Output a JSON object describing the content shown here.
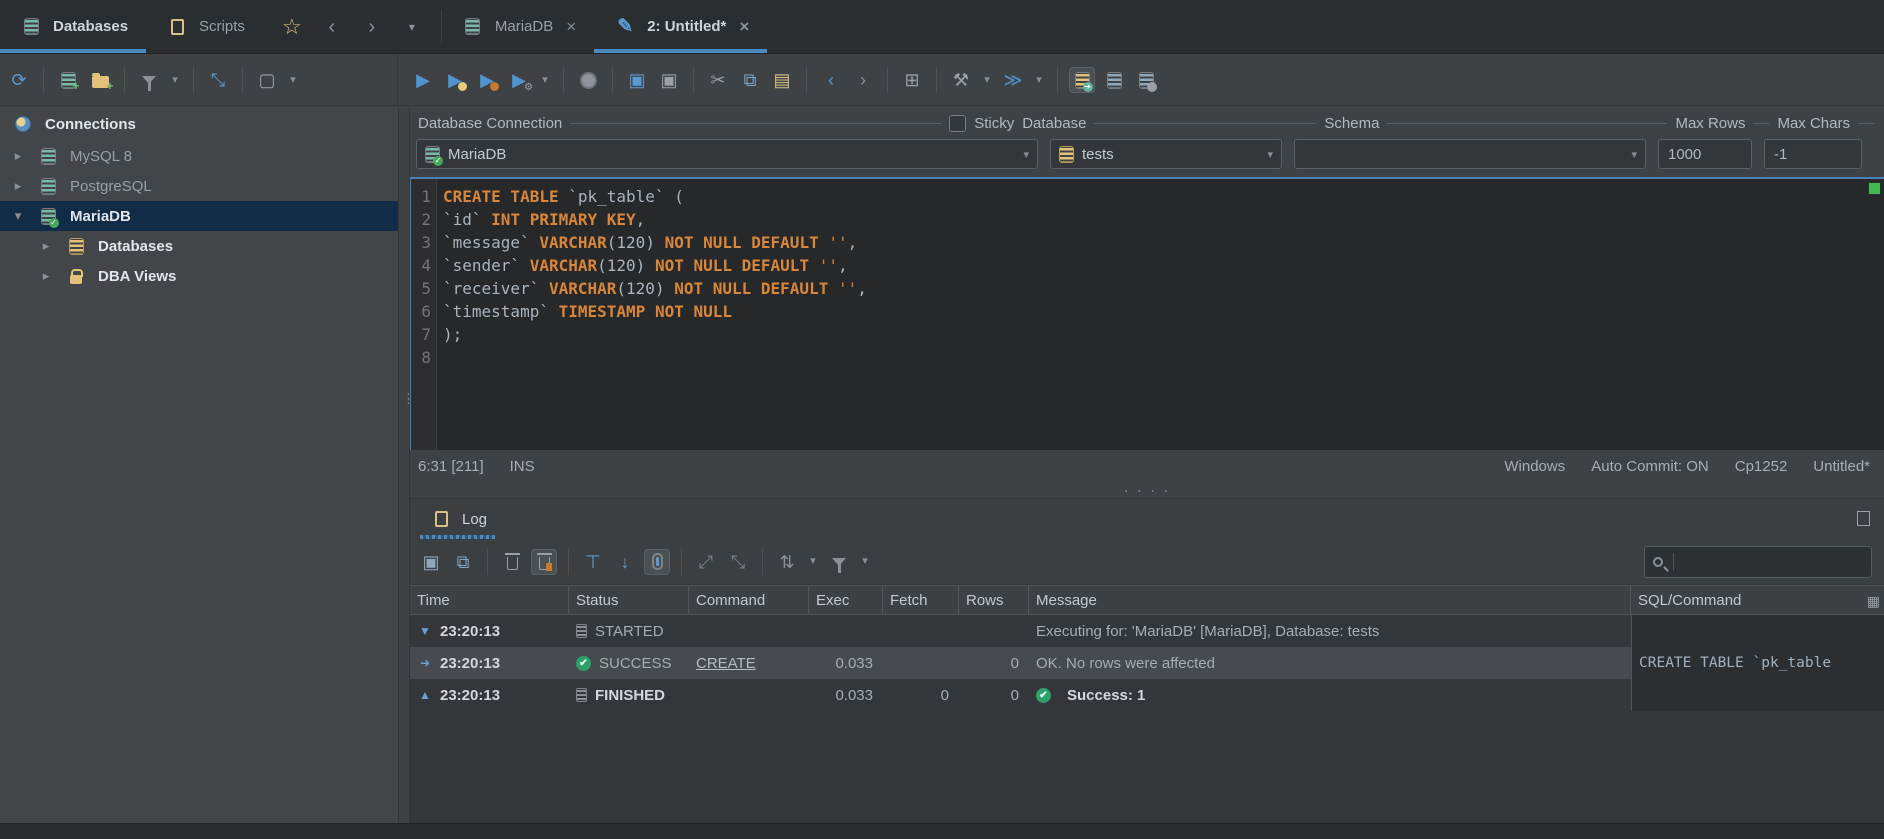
{
  "colors": {
    "accent_blue": "#4a8ac2",
    "icon_blue": "#5a9bd4",
    "icon_yellow": "#e3c178",
    "icon_orange": "#c87a32",
    "success_green": "#2ea06a",
    "keyword_orange": "#d8863b",
    "selection_navy": "#102c47",
    "overview_green": "#3fb950"
  },
  "tabbar": {
    "part_tabs": [
      {
        "label": "Databases",
        "active": true
      },
      {
        "label": "Scripts",
        "active": false
      }
    ],
    "nav_icons": [
      "favorites-star-icon",
      "history-back-icon",
      "history-forward-icon",
      "tab-list-chevron-icon"
    ],
    "editor_tabs": [
      {
        "label": "MariaDB",
        "close": "×",
        "active": false
      },
      {
        "label": "2: Untitled*",
        "close": "×",
        "active": true
      }
    ]
  },
  "sidebar_toolbar": [
    {
      "n": "refresh-button",
      "g": "⟳",
      "c": "#5a9bd4"
    },
    {
      "sep": true
    },
    {
      "n": "new-connection-button",
      "type": "db",
      "plus": true
    },
    {
      "n": "new-folder-button",
      "type": "folder"
    },
    {
      "sep": true
    },
    {
      "n": "filter-connections-button",
      "type": "funnel"
    },
    {
      "n": "filter-caret",
      "g": "▾",
      "c": "#8b9196",
      "caret": true
    },
    {
      "sep": true
    },
    {
      "n": "collapse-all-button",
      "g": "⤡",
      "c": "#5a9bd4"
    },
    {
      "sep": true
    },
    {
      "n": "configure-view-button",
      "g": "▢",
      "c": "#9aa0a6"
    },
    {
      "n": "view-caret",
      "g": "▾",
      "c": "#8b9196",
      "caret": true
    }
  ],
  "editor_toolbar": [
    {
      "n": "execute-statement-button",
      "g": "▶",
      "c": "#4e94ce"
    },
    {
      "n": "execute-in-new-tab-button",
      "g": "▶",
      "c": "#4e94ce",
      "dot": "#e8c87a"
    },
    {
      "n": "execute-script-button",
      "g": "▶",
      "c": "#4e94ce",
      "dot": "#c87a32"
    },
    {
      "n": "execute-with-settings-button",
      "g": "▶",
      "c": "#4e94ce",
      "gear": true
    },
    {
      "n": "execute-caret",
      "g": "▾",
      "c": "#8b9196",
      "caret": true
    },
    {
      "sep": true
    },
    {
      "n": "stop-button",
      "type": "stop"
    },
    {
      "sep": true
    },
    {
      "n": "save-button",
      "g": "▣",
      "c": "#5a9bd4"
    },
    {
      "n": "save-as-button",
      "g": "▣",
      "c": "#9aa0a6"
    },
    {
      "sep": true
    },
    {
      "n": "cut-button",
      "g": "✂",
      "c": "#9aa0a6"
    },
    {
      "n": "copy-button",
      "g": "⧉",
      "c": "#7fa7c9"
    },
    {
      "n": "paste-button",
      "g": "▤",
      "c": "#d9c084"
    },
    {
      "sep": true
    },
    {
      "n": "back-button",
      "g": "‹",
      "c": "#5a9bd4"
    },
    {
      "n": "forward-button",
      "g": "›",
      "c": "#8b9196"
    },
    {
      "sep": true
    },
    {
      "n": "er-diagram-button",
      "g": "⊞",
      "c": "#9aa0a6"
    },
    {
      "sep": true
    },
    {
      "n": "tools-button",
      "g": "⚒",
      "c": "#9aa0a6"
    },
    {
      "n": "tools-caret",
      "g": "▾",
      "c": "#8b9196",
      "caret": true
    },
    {
      "n": "transfer-button",
      "g": "≫",
      "c": "#4e94ce"
    },
    {
      "n": "transfer-caret",
      "g": "▾",
      "c": "#8b9196",
      "caret": true
    },
    {
      "sep": true
    },
    {
      "n": "export-result-button",
      "type": "db",
      "dbc": "#e3c178",
      "sel": true,
      "badge": "➔"
    },
    {
      "n": "save-to-database-button",
      "type": "db",
      "dbc": "#8fa8bd"
    },
    {
      "n": "mapping-button",
      "type": "db",
      "dbc": "#8fa8bd",
      "dotc": "#9aa0a6"
    }
  ],
  "connections": {
    "title": "Connections",
    "items": [
      {
        "chev": "▸",
        "icon": "db",
        "label": "MySQL 8",
        "bold": false,
        "indent": 0
      },
      {
        "chev": "▸",
        "icon": "db",
        "label": "PostgreSQL",
        "bold": false,
        "indent": 0
      },
      {
        "chev": "▾",
        "icon": "db-check",
        "label": "MariaDB",
        "bold": true,
        "indent": 0,
        "selected": true
      },
      {
        "chev": "▸",
        "icon": "db-yellow",
        "label": "Databases",
        "bold": true,
        "indent": 1
      },
      {
        "chev": "▸",
        "icon": "lock",
        "label": "DBA Views",
        "bold": true,
        "indent": 1
      }
    ]
  },
  "connbar": {
    "labels": {
      "connection": "Database Connection",
      "sticky": "Sticky",
      "database": "Database",
      "schema": "Schema",
      "max_rows": "Max Rows",
      "max_chars": "Max Chars"
    },
    "connection_value": "MariaDB",
    "database_value": "tests",
    "schema_value": "",
    "max_rows_value": "1000",
    "max_chars_value": "-1"
  },
  "editor": {
    "lines": [
      {
        "num": "1",
        "segs": [
          {
            "c": "kw",
            "t": "CREATE TABLE"
          },
          {
            "c": "pl",
            "t": " "
          },
          {
            "c": "id",
            "t": "`pk_table`"
          },
          {
            "c": "pl",
            "t": " ("
          }
        ]
      },
      {
        "num": "2",
        "segs": [
          {
            "c": "id",
            "t": "`id`"
          },
          {
            "c": "pl",
            "t": " "
          },
          {
            "c": "kw",
            "t": "INT PRIMARY KEY"
          },
          {
            "c": "pl",
            "t": ","
          }
        ]
      },
      {
        "num": "3",
        "segs": [
          {
            "c": "id",
            "t": "`message`"
          },
          {
            "c": "pl",
            "t": " "
          },
          {
            "c": "kw",
            "t": "VARCHAR"
          },
          {
            "c": "pl",
            "t": "(120) "
          },
          {
            "c": "kw",
            "t": "NOT NULL DEFAULT"
          },
          {
            "c": "pl",
            "t": " "
          },
          {
            "c": "str",
            "t": "''"
          },
          {
            "c": "pl",
            "t": ","
          }
        ]
      },
      {
        "num": "4",
        "segs": [
          {
            "c": "id",
            "t": "`sender`"
          },
          {
            "c": "pl",
            "t": " "
          },
          {
            "c": "kw",
            "t": "VARCHAR"
          },
          {
            "c": "pl",
            "t": "(120) "
          },
          {
            "c": "kw",
            "t": "NOT NULL DEFAULT"
          },
          {
            "c": "pl",
            "t": " "
          },
          {
            "c": "str",
            "t": "''"
          },
          {
            "c": "pl",
            "t": ","
          }
        ]
      },
      {
        "num": "5",
        "segs": [
          {
            "c": "id",
            "t": "`receiver`"
          },
          {
            "c": "pl",
            "t": " "
          },
          {
            "c": "kw",
            "t": "VARCHAR"
          },
          {
            "c": "pl",
            "t": "(120) "
          },
          {
            "c": "kw",
            "t": "NOT NULL DEFAULT"
          },
          {
            "c": "pl",
            "t": " "
          },
          {
            "c": "str",
            "t": "''"
          },
          {
            "c": "pl",
            "t": ","
          }
        ]
      },
      {
        "num": "6",
        "segs": [
          {
            "c": "id",
            "t": "`timestamp`"
          },
          {
            "c": "pl",
            "t": " "
          },
          {
            "c": "kw",
            "t": "TIMESTAMP NOT NULL"
          }
        ]
      },
      {
        "num": "7",
        "segs": [
          {
            "c": "pl",
            "t": ");"
          }
        ]
      },
      {
        "num": "8",
        "segs": []
      }
    ],
    "status_left": {
      "position": "6:31 [211]",
      "mode": "INS"
    },
    "status_right": [
      "Windows",
      "Auto Commit: ON",
      "Cp1252",
      "Untitled*"
    ]
  },
  "sash_dots": "· · · ·",
  "log": {
    "tab_label": "Log",
    "toolbar": [
      {
        "n": "save-log-button",
        "g": "▣",
        "c": "#8fa8bd"
      },
      {
        "n": "copy-log-button",
        "g": "⧉",
        "c": "#7fa7c9"
      },
      {
        "sep": true
      },
      {
        "n": "clear-log-button",
        "type": "trash"
      },
      {
        "n": "clear-log-settings-button",
        "type": "trash-orange",
        "sel": true
      },
      {
        "sep": true
      },
      {
        "n": "scroll-to-start-button",
        "g": "⊤",
        "c": "#5a9bd4"
      },
      {
        "n": "scroll-to-end-button",
        "g": "↓",
        "c": "#5a9bd4"
      },
      {
        "n": "scroll-lock-button",
        "type": "slock",
        "sel": true
      },
      {
        "sep": true
      },
      {
        "n": "expand-all-button",
        "g": "⤢",
        "c": "#7d8388"
      },
      {
        "n": "collapse-all-log-button",
        "g": "⤡",
        "c": "#7d8388"
      },
      {
        "sep": true
      },
      {
        "n": "wrap-lines-button",
        "g": "⇅",
        "c": "#8b9196"
      },
      {
        "n": "wrap-caret",
        "g": "▾",
        "c": "#8b9196",
        "caret": true
      },
      {
        "n": "filter-log-button",
        "type": "funnel"
      },
      {
        "n": "filter-log-caret",
        "g": "▾",
        "c": "#8b9196",
        "caret": true
      }
    ],
    "search_placeholder": "",
    "headers": [
      "Time",
      "Status",
      "Command",
      "Exec",
      "Fetch",
      "Rows",
      "Message",
      "SQL/Command"
    ],
    "rows": [
      {
        "expander": "▼",
        "time": "23:20:13",
        "status_icon": "pending",
        "status": "STARTED",
        "status_bold": false,
        "command": "",
        "exec": "",
        "fetch": "",
        "rows": "",
        "msg_icon": "",
        "message": "Executing for: 'MariaDB' [MariaDB], Database: tests",
        "msg_bold": false,
        "sql": "",
        "selected": false
      },
      {
        "expander": "➜",
        "time": "23:20:13",
        "status_icon": "success",
        "status": "SUCCESS",
        "status_bold": false,
        "command": "CREATE",
        "exec": "0.033",
        "fetch": "",
        "rows": "0",
        "msg_icon": "",
        "message": "OK. No rows were affected",
        "msg_bold": false,
        "sql": "CREATE TABLE `pk_table",
        "selected": true
      },
      {
        "expander": "▲",
        "time": "23:20:13",
        "status_icon": "pending",
        "status": "FINISHED",
        "status_bold": true,
        "command": "",
        "exec": "0.033",
        "fetch": "0",
        "rows": "0",
        "msg_icon": "success",
        "message": "Success: 1",
        "msg_bold": true,
        "sql": "",
        "selected": false
      }
    ]
  }
}
